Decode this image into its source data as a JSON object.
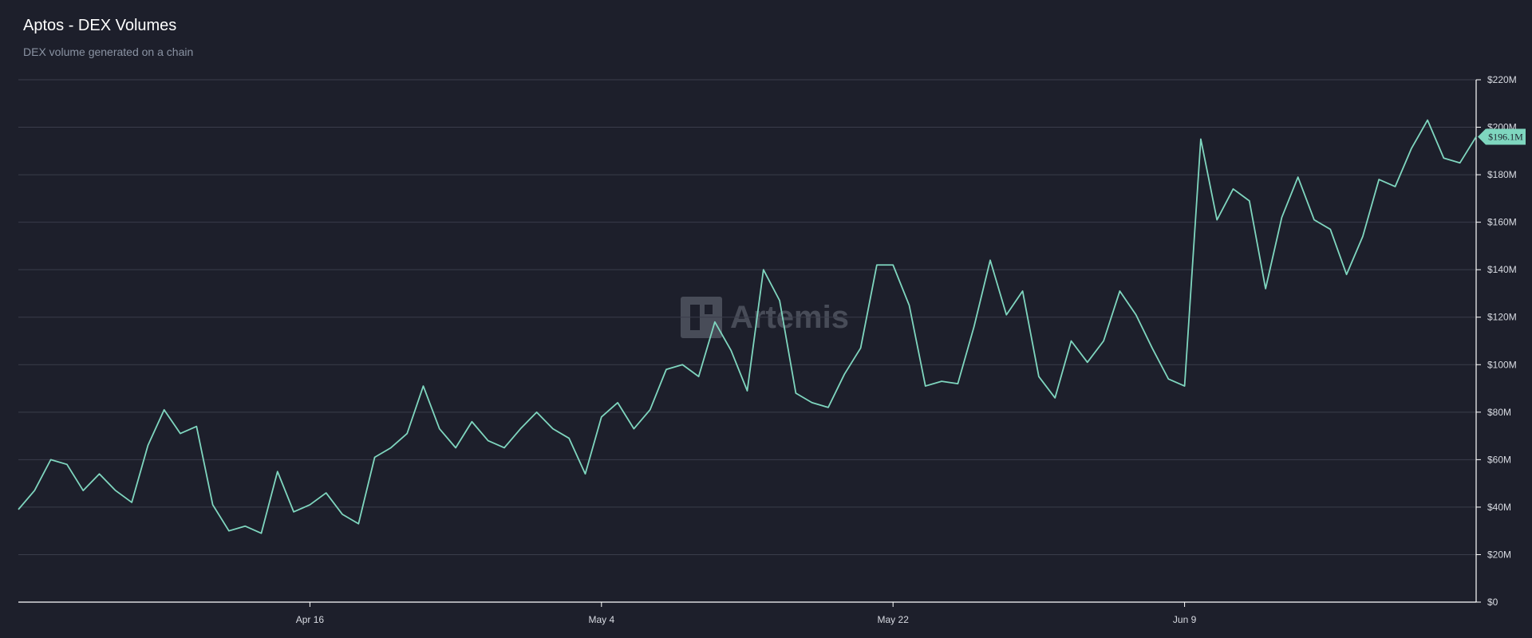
{
  "header": {
    "title": "Aptos - DEX Volumes",
    "subtitle": "DEX volume generated on a chain"
  },
  "watermark": {
    "text": "Artemis",
    "icon": "artemis-logo-icon"
  },
  "colors": {
    "background": "#1d1f2b",
    "line": "#7fd6bf",
    "grid": "#3a3d4b",
    "axis": "#ffffff",
    "label_bg": "#7fd6bf"
  },
  "chart_data": {
    "type": "line",
    "title": "Aptos - DEX Volumes",
    "subtitle": "DEX volume generated on a chain",
    "xlabel": "",
    "ylabel": "",
    "x_ticks": [
      "Apr 16",
      "May 4",
      "May 22",
      "Jun 9"
    ],
    "y_ticks": [
      "$0",
      "$20M",
      "$40M",
      "$60M",
      "$80M",
      "$100M",
      "$120M",
      "$140M",
      "$160M",
      "$180M",
      "$200M",
      "$220M"
    ],
    "ylim": [
      0,
      220
    ],
    "y_unit": "$M",
    "grid": true,
    "last_value_label": "$196.1M",
    "series": [
      {
        "values": [
          39,
          47,
          60,
          58,
          47,
          54,
          47,
          42,
          66,
          81,
          71,
          74,
          41,
          30,
          32,
          29,
          55,
          38,
          41,
          46,
          37,
          33,
          61,
          65,
          71,
          91,
          73,
          65,
          76,
          68,
          65,
          73,
          80,
          73,
          69,
          54,
          78,
          84,
          73,
          81,
          98,
          100,
          95,
          118,
          106,
          89,
          140,
          127,
          88,
          84,
          82,
          96,
          107,
          142,
          142,
          125,
          91,
          93,
          92,
          116,
          144,
          121,
          131,
          95,
          86,
          110,
          101,
          110,
          131,
          121,
          107,
          94,
          91,
          195,
          161,
          174,
          169,
          132,
          162,
          179,
          161,
          157,
          138,
          154,
          178,
          175,
          191,
          203,
          187,
          185,
          196
        ]
      }
    ],
    "x_tick_indices": [
      18,
      36,
      54,
      72
    ]
  }
}
